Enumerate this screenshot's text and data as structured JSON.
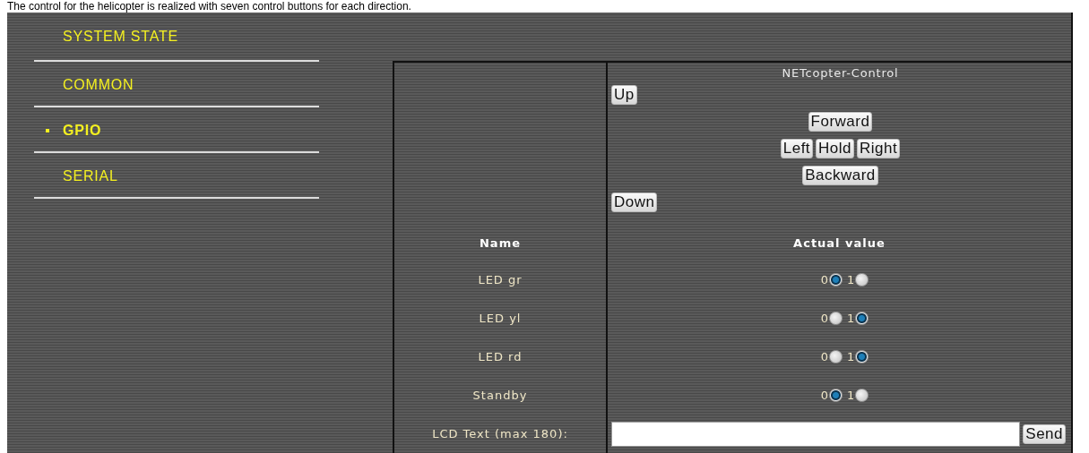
{
  "caption": "The control for the helicopter is realized with seven control buttons for each direction.",
  "sidebar": {
    "items": [
      {
        "label": "SYSTEM STATE",
        "selected": false
      },
      {
        "label": "COMMON",
        "selected": false
      },
      {
        "label": "GPIO",
        "selected": true
      },
      {
        "label": "SERIAL",
        "selected": false
      }
    ]
  },
  "control": {
    "title": "NETcopter-Control",
    "rows": [
      {
        "kind": "side",
        "buttons": [
          "Up"
        ]
      },
      {
        "kind": "center",
        "buttons": [
          "Forward"
        ]
      },
      {
        "kind": "center",
        "buttons": [
          "Left",
          "Hold",
          "Right"
        ]
      },
      {
        "kind": "center",
        "buttons": [
          "Backward"
        ]
      },
      {
        "kind": "side",
        "buttons": [
          "Down"
        ]
      }
    ]
  },
  "gpio": {
    "columns": [
      "Name",
      "Actual value"
    ],
    "rows": [
      {
        "name": "LED gr",
        "options": [
          {
            "label": "0",
            "selected": true
          },
          {
            "label": "1",
            "selected": false
          }
        ]
      },
      {
        "name": "LED yl",
        "options": [
          {
            "label": "0",
            "selected": false
          },
          {
            "label": "1",
            "selected": true
          }
        ]
      },
      {
        "name": "LED rd",
        "options": [
          {
            "label": "0",
            "selected": false
          },
          {
            "label": "1",
            "selected": true
          }
        ]
      },
      {
        "name": "Standby",
        "options": [
          {
            "label": "0",
            "selected": true
          },
          {
            "label": "1",
            "selected": false
          }
        ]
      }
    ]
  },
  "lcd": {
    "label": "LCD Text (max 180):",
    "button": "Send"
  }
}
